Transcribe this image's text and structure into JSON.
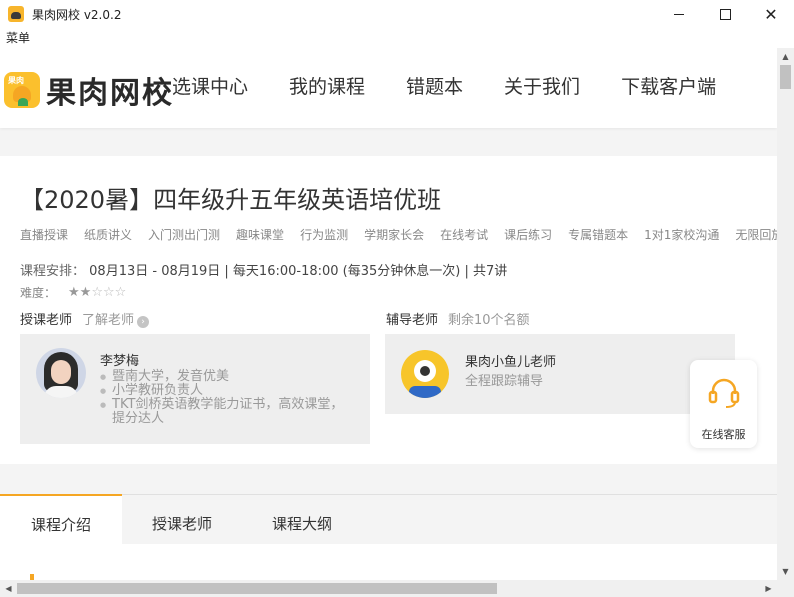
{
  "window": {
    "title": "果肉网校 v2.0.2",
    "menu_label": "菜单"
  },
  "header": {
    "logo_text": "果肉网校",
    "logo_badge_text": "果肉",
    "nav": [
      "选课中心",
      "我的课程",
      "错题本",
      "关于我们",
      "下载客户端"
    ]
  },
  "course": {
    "title": "【2020暑】四年级升五年级英语培优班",
    "tags": [
      "直播授课",
      "纸质讲义",
      "入门测出门测",
      "趣味课堂",
      "行为监测",
      "学期家长会",
      "在线考试",
      "课后练习",
      "专属错题本",
      "1对1家校沟通",
      "无限回放"
    ],
    "schedule_label": "课程安排：",
    "schedule_value": "08月13日 - 08月19日 | 每天16:00-18:00 (每35分钟休息一次) | 共7讲",
    "difficulty_label": "难度：",
    "difficulty_stars": 2,
    "difficulty_max": 5
  },
  "instructor": {
    "heading": "授课老师",
    "link": "了解老师",
    "name": "李梦梅",
    "bullets": [
      "暨南大学，发音优美",
      "小学教研负责人",
      "TKT剑桥英语教学能力证书，高效课堂，提分达人"
    ]
  },
  "tutor": {
    "heading": "辅导老师",
    "note": "剩余10个名额",
    "name": "果肉小鱼儿老师",
    "desc": "全程跟踪辅导"
  },
  "service": {
    "label": "在线客服"
  },
  "tabs": [
    "课程介绍",
    "授课老师",
    "课程大纲"
  ],
  "colors": {
    "accent": "#f5a623",
    "logo_yellow": "#fbc02d"
  }
}
